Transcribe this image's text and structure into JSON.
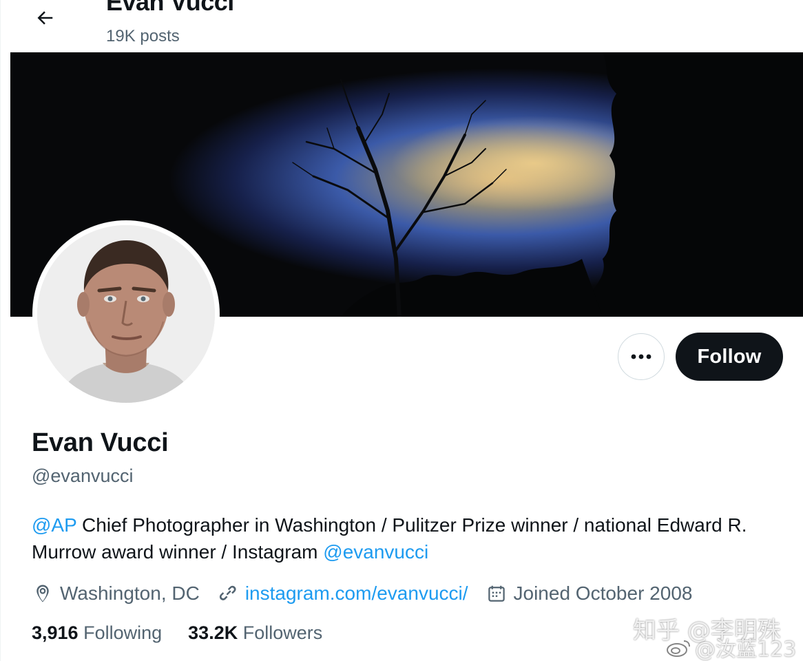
{
  "header": {
    "back_icon": "arrow-left-icon",
    "name": "Evan Vucci",
    "posts_count": "19K posts"
  },
  "banner": {
    "description_icon": "night-sky-banner"
  },
  "actions": {
    "more_icon": "more-dots-icon",
    "follow_label": "Follow"
  },
  "profile": {
    "display_name": "Evan Vucci",
    "handle": "@evanvucci",
    "bio": {
      "mention_ap": "@AP",
      "text_1": " Chief Photographer in Washington / Pulitzer Prize winner / national Edward R. Murrow award winner / Instagram ",
      "mention_instagram": "@evanvucci"
    },
    "location": "Washington, DC",
    "website": "instagram.com/evanvucci/",
    "joined": "Joined October 2008",
    "following_count": "3,916",
    "following_label": "Following",
    "followers_count": "33.2K",
    "followers_label": "Followers"
  },
  "watermark": {
    "line1": "知乎 @李明殊",
    "line2": "@汝蓝123"
  },
  "colors": {
    "link": "#1d9bf0",
    "text_primary": "#0f1419",
    "text_secondary": "#536471",
    "follow_bg": "#0f1419"
  }
}
